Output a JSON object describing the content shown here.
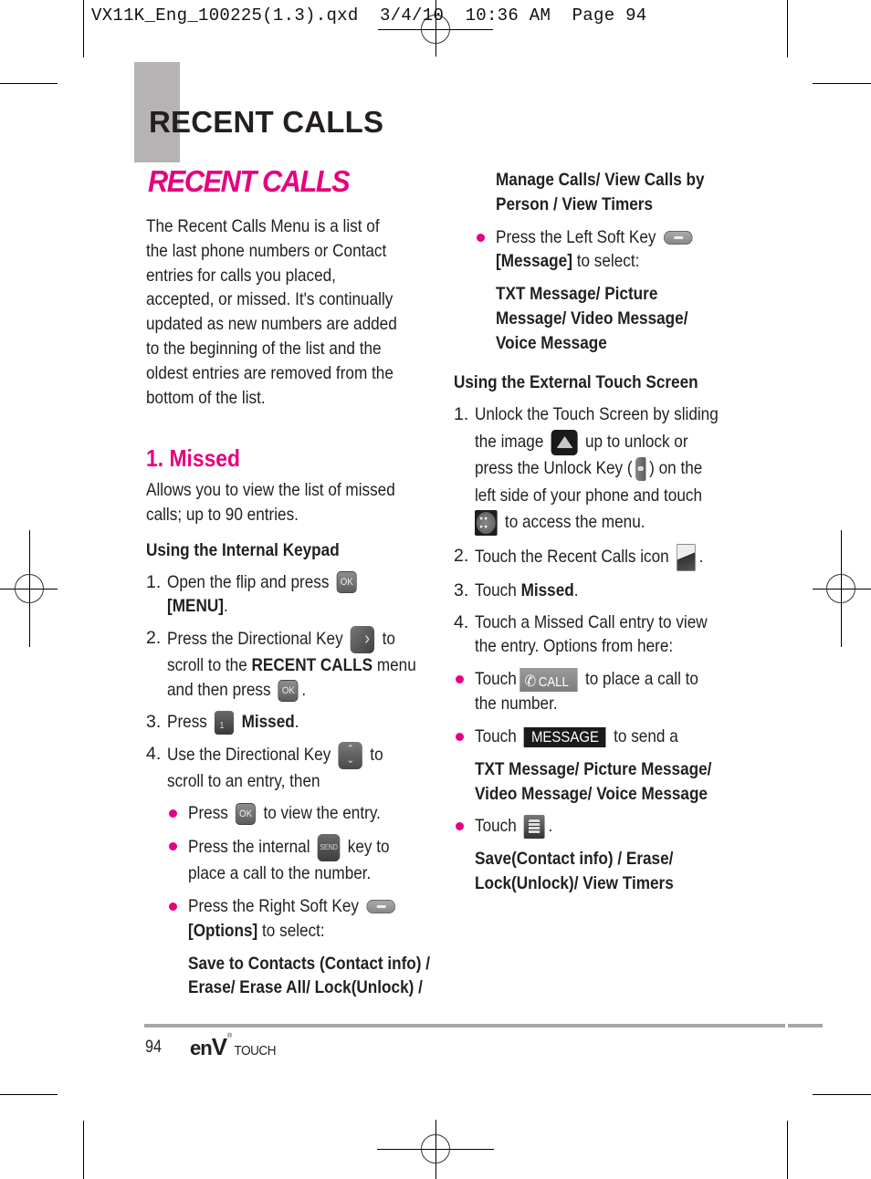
{
  "slug": "VX11K_Eng_100225(1.3).qxd  3/4/10  10:36 AM  Page 94",
  "section_tab_title": "RECENT CALLS",
  "page_heading": "RECENT CALLS",
  "intro": "The Recent Calls Menu is a list of the last phone numbers or Contact entries for calls you placed, accepted, or missed. It's continually updated as new numbers are added to the beginning of the list and the oldest entries are removed from the bottom of the list.",
  "intro_lines": [
    "The Recent Calls Menu is a list of",
    "the last phone numbers or Contact",
    "entries for calls you placed,",
    "accepted, or missed. It's continually",
    "updated as new numbers are added",
    "to the beginning of the list and the",
    "oldest entries are removed from the",
    "bottom of the list."
  ],
  "missed": {
    "heading": "1. Missed",
    "desc_lines": [
      "Allows you to view the list of missed",
      "calls; up to 90 entries."
    ],
    "internal_heading": "Using the Internal Keypad",
    "steps": {
      "s1": {
        "num": "1.",
        "a": "Open the flip and press",
        "key": "OK",
        "b": "[MENU]",
        "c": "."
      },
      "s2": {
        "num": "2.",
        "a": "Press the Directional Key",
        "b": "to",
        "c": "scroll to the",
        "d": "RECENT CALLS",
        "e": "menu",
        "f": "and then press",
        "key": "OK",
        "g": "."
      },
      "s3": {
        "num": "3.",
        "a": "Press",
        "key": "1",
        "b": "Missed",
        "c": "."
      },
      "s4": {
        "num": "4.",
        "a": "Use the Directional Key",
        "b": "to",
        "c": "scroll to an entry, then"
      }
    },
    "bullets": {
      "b1": {
        "a": "Press",
        "key": "OK",
        "b": "to view the entry."
      },
      "b2": {
        "a": "Press the internal",
        "key": "SEND",
        "b": "key to",
        "c": "place a call to the number."
      },
      "b3": {
        "a": "Press the Right Soft Key",
        "b": "[Options]",
        "c": "to select:",
        "opts1": "Save to Contacts (Contact info) /",
        "opts2": "Erase/ Erase All/ Lock(Unlock) /",
        "opts3": "Manage Calls/ View Calls by",
        "opts4": "Person / View Timers"
      },
      "b4": {
        "a": "Press the Left Soft Key",
        "b": "[Message]",
        "c": "to select:",
        "opts1": "TXT Message/ Picture",
        "opts2": "Message/ Video Message/",
        "opts3": "Voice Message"
      }
    },
    "external_heading": "Using the External Touch Screen",
    "ext_steps": {
      "e1": {
        "num": "1.",
        "l1": "Unlock the Touch Screen by sliding",
        "l2a": "the image",
        "l2b": "up to unlock or",
        "l3a": "press the Unlock Key (",
        "l3b": ") on the",
        "l4": "left side of your phone and touch",
        "l5": "to access the menu."
      },
      "e2": {
        "num": "2.",
        "a": "Touch the Recent Calls icon",
        "b": "."
      },
      "e3": {
        "num": "3.",
        "a": "Touch",
        "b": "Missed",
        "c": "."
      },
      "e4": {
        "num": "4.",
        "l1": "Touch a Missed Call entry to view",
        "l2": "the entry. Options from here:"
      }
    },
    "ext_bullets": {
      "x1": {
        "a": "Touch",
        "btn": "CALL",
        "b": "to place a call to",
        "c": "the number."
      },
      "x2": {
        "a": "Touch",
        "btn": "MESSAGE",
        "b": "to send a",
        "opts1": "TXT Message/ Picture Message/",
        "opts2": "Video Message/ Voice Message"
      },
      "x3": {
        "a": "Touch",
        "b": ".",
        "opts1": "Save(Contact info) / Erase/",
        "opts2": "Lock(Unlock)/ View Timers"
      }
    }
  },
  "footer": {
    "page_number": "94",
    "brand_en": "en",
    "brand_v": "V",
    "brand_tm": "®",
    "brand_touch": "TOUCH"
  },
  "colors": {
    "accent_pink": "#e6007e",
    "tab_grey": "#b5b3b4",
    "rule_grey": "#a7a5a6"
  }
}
